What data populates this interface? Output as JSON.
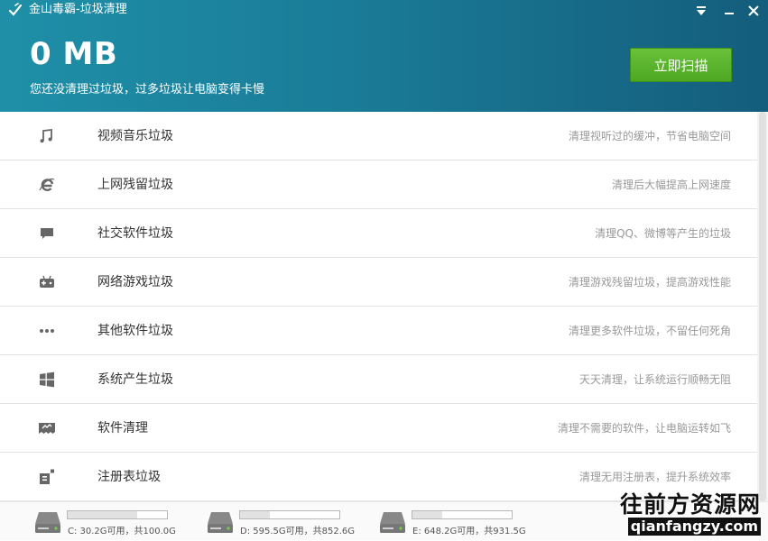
{
  "window": {
    "title": "金山毒霸-垃圾清理"
  },
  "header": {
    "size": "0 MB",
    "subtitle": "您还没清理过垃圾，过多垃圾让电脑变得卡慢",
    "scan_button": "立即扫描"
  },
  "categories": [
    {
      "icon": "music-note-icon",
      "label": "视频音乐垃圾",
      "desc": "清理视听过的缓冲，节省电脑空间"
    },
    {
      "icon": "ie-browser-icon",
      "label": "上网残留垃圾",
      "desc": "清理后大幅提高上网速度"
    },
    {
      "icon": "chat-bubble-icon",
      "label": "社交软件垃圾",
      "desc": "清理QQ、微博等产生的垃圾"
    },
    {
      "icon": "game-controller-icon",
      "label": "网络游戏垃圾",
      "desc": "清理游戏残留垃圾，提高游戏性能"
    },
    {
      "icon": "more-dots-icon",
      "label": "其他软件垃圾",
      "desc": "清理更多软件垃圾，不留任何死角"
    },
    {
      "icon": "windows-logo-icon",
      "label": "系统产生垃圾",
      "desc": "天天清理，让系统运行顺畅无阻"
    },
    {
      "icon": "uninstall-icon",
      "label": "软件清理",
      "desc": "清理不需要的软件，让电脑运转如飞"
    },
    {
      "icon": "registry-icon",
      "label": "注册表垃圾",
      "desc": "清理无用注册表，提升系统效率"
    }
  ],
  "disks": [
    {
      "label": "C: 30.2G可用，共100.0G",
      "used_fraction": 0.698
    },
    {
      "label": "D: 595.5G可用，共852.6G",
      "used_fraction": 0.302
    },
    {
      "label": "E: 648.2G可用，共931.5G",
      "used_fraction": 0.304
    }
  ],
  "watermark": {
    "name": "往前方资源网",
    "url": "qianfangzy.com"
  },
  "colors": {
    "header_start": "#1f8fa8",
    "header_end": "#145d7c",
    "scan_button": "#5cb52e",
    "desc_text": "#999999"
  }
}
